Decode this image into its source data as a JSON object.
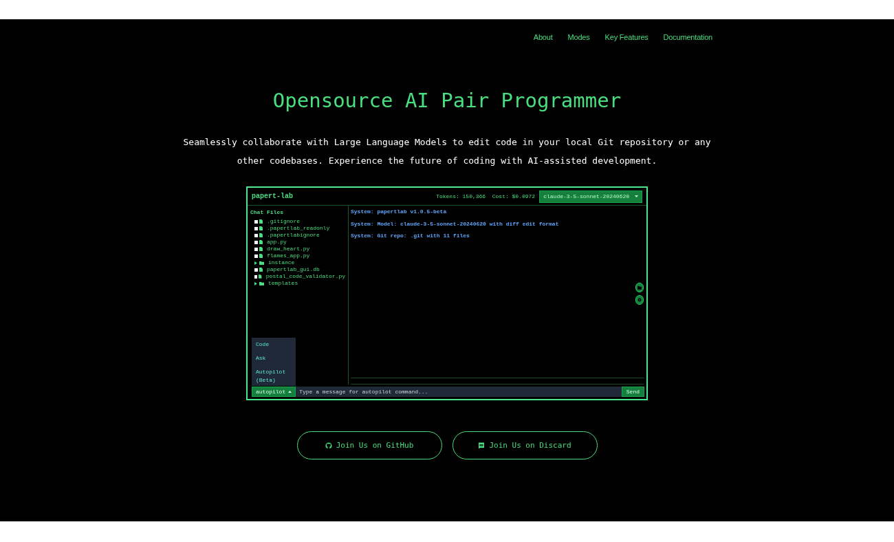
{
  "nav": {
    "links": [
      "About",
      "Modes",
      "Key Features",
      "Documentation"
    ]
  },
  "hero": {
    "title": "Opensource AI Pair Programmer",
    "subtitle": "Seamlessly collaborate with Large Language Models to edit code in your local Git repository or any other codebases. Experience the future of coding with AI-assisted development."
  },
  "app": {
    "title": "papert-lab",
    "tokens": "Tokens: 150,366",
    "cost": "Cost: $0.0972",
    "model": "claude-3-5-sonnet-20240620",
    "files_heading": "Chat Files",
    "files": [
      {
        "kind": "file",
        "name": ".gitignore",
        "checked": false
      },
      {
        "kind": "file",
        "name": ".papertlab_readonly",
        "checked": false
      },
      {
        "kind": "file",
        "name": ".papertlabignore",
        "checked": false
      },
      {
        "kind": "file",
        "name": "app.py",
        "checked": false
      },
      {
        "kind": "file",
        "name": "draw_heart.py",
        "checked": false
      },
      {
        "kind": "file",
        "name": "flames_app.py",
        "checked": false
      },
      {
        "kind": "folder",
        "name": "instance",
        "expanded": false
      },
      {
        "kind": "file",
        "name": "papertlab_gui.db",
        "checked": false
      },
      {
        "kind": "file",
        "name": "postal_code_validator.py",
        "checked": false
      },
      {
        "kind": "folder",
        "name": "templates",
        "expanded": false
      }
    ],
    "messages": [
      "System: papertlab v1.0.5-beta",
      "System: Model: claude-3-5-sonnet-20240620 with diff edit format",
      "System: Git repo: .git with 11 files"
    ],
    "mode_menu": [
      "Code",
      "Ask",
      "Autopilot (Beta)"
    ],
    "mode_button": "autopilot",
    "input": {
      "placeholder": "Type a message for autopilot command..."
    },
    "send": "Send"
  },
  "buttons": [
    {
      "kind": "github",
      "label": "Join Us on GitHub"
    },
    {
      "kind": "discord",
      "label": "Join Us on Discard"
    }
  ]
}
